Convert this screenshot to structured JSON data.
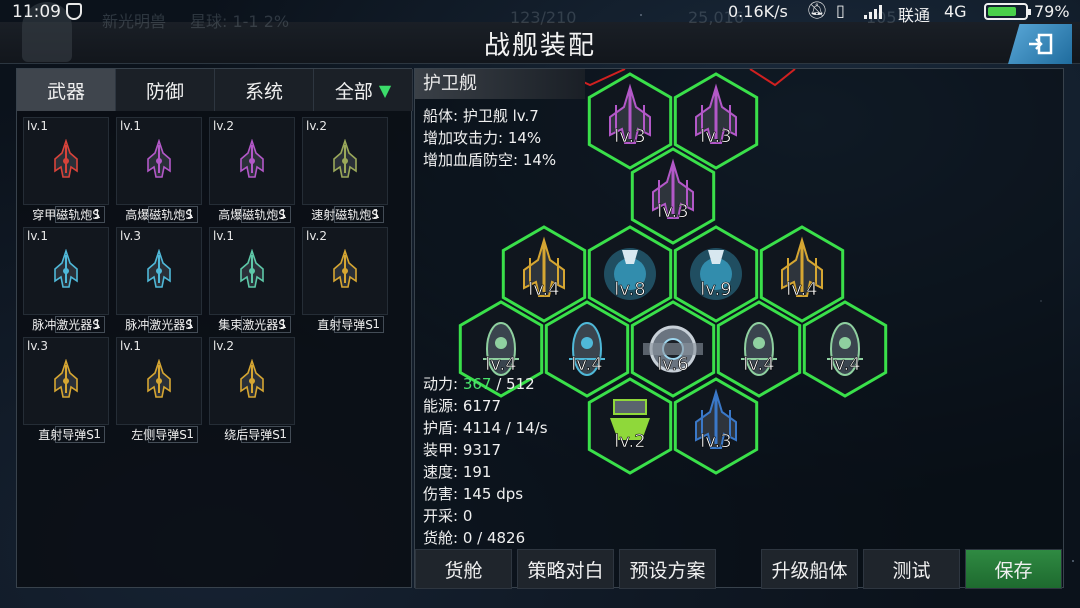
{
  "status_bar": {
    "time": "11:09",
    "net_speed": "0.16K/s",
    "carrier": "联通",
    "network": "4G",
    "battery_pct": "79%",
    "battery_level": 0.79
  },
  "game_bar": {
    "player_name": "新光明兽",
    "planet": "星球: 1-1  2%",
    "stat_a": "123/210",
    "stat_b": "25,016",
    "stat_c": "105"
  },
  "header": {
    "title": "战舰装配"
  },
  "left_panel": {
    "tabs": [
      {
        "label": "武器",
        "active": true
      },
      {
        "label": "防御",
        "active": false
      },
      {
        "label": "系统",
        "active": false
      },
      {
        "label": "全部",
        "active": false
      }
    ],
    "items": [
      {
        "level": "lv.1",
        "count": "1",
        "name": "穿甲磁轨炮S",
        "color": "#d8433a"
      },
      {
        "level": "lv.1",
        "count": "1",
        "name": "高爆磁轨炮S",
        "color": "#b358c8"
      },
      {
        "level": "lv.2",
        "count": "1",
        "name": "高爆磁轨炮S",
        "color": "#b358c8"
      },
      {
        "level": "lv.2",
        "count": "1",
        "name": "速射磁轨炮S",
        "color": "#9aa85a"
      },
      {
        "level": "lv.1",
        "count": "1",
        "name": "脉冲激光器S",
        "color": "#4fb8d8"
      },
      {
        "level": "lv.3",
        "count": "1",
        "name": "脉冲激光器S",
        "color": "#4fb8d8"
      },
      {
        "level": "lv.1",
        "count": "1",
        "name": "集束激光器S",
        "color": "#5ec8a8"
      },
      {
        "level": "lv.2",
        "count": "1",
        "name": "直射导弹S",
        "color": "#d6a632"
      },
      {
        "level": "lv.3",
        "count": "1",
        "name": "直射导弹S",
        "color": "#d6a632"
      },
      {
        "level": "lv.1",
        "count": "1",
        "name": "左侧导弹S",
        "color": "#d6a632"
      },
      {
        "level": "lv.2",
        "count": "1",
        "name": "绕后导弹S",
        "color": "#d6a632"
      }
    ]
  },
  "hull": {
    "name": "护卫舰",
    "hull_line": "船体: 护卫舰 lv.7",
    "atk_line": "增加攻击力: 14%",
    "hp_line": "增加血盾防空: 14%"
  },
  "stats": {
    "power_label": "动力: ",
    "power_used": "367",
    "power_total": " / 512",
    "energy": "能源: 6177",
    "shield": "护盾: 4114 / 14/s",
    "armor": "装甲: 9317",
    "speed": "速度: 191",
    "damage": "伤害: 145 dps",
    "mining": "开采: 0",
    "cargo": "货舱: 0 / 4826"
  },
  "modules": [
    {
      "label": "lv.3",
      "color": "#b358c8",
      "kind": "weapon"
    },
    {
      "label": "lv.3",
      "color": "#b358c8",
      "kind": "weapon"
    },
    {
      "label": "lv.3",
      "color": "#b358c8",
      "kind": "weapon"
    },
    {
      "label": "lv.4",
      "color": "#d6a632",
      "kind": "weapon"
    },
    {
      "label": "lv.8",
      "color": "#3fb8e0",
      "kind": "orb"
    },
    {
      "label": "lv.9",
      "color": "#3fb8e0",
      "kind": "orb"
    },
    {
      "label": "lv.4",
      "color": "#d6a632",
      "kind": "weapon"
    },
    {
      "label": "lv.4",
      "color": "#8fd0a0",
      "kind": "pod"
    },
    {
      "label": "lv.4",
      "color": "#4fb8d8",
      "kind": "pod"
    },
    {
      "label": "lv.6",
      "color": "#c8d0d8",
      "kind": "core"
    },
    {
      "label": "lv.4",
      "color": "#8fd0a0",
      "kind": "pod"
    },
    {
      "label": "lv.4",
      "color": "#8fd0a0",
      "kind": "pod"
    },
    {
      "label": "lv.2",
      "color": "#8fd83a",
      "kind": "engine"
    },
    {
      "label": "lv.3",
      "color": "#3a78c8",
      "kind": "weapon"
    }
  ],
  "bottom_buttons": {
    "cargo": "货舱",
    "strategy": "策略对白",
    "preset": "预设方案",
    "upgrade": "升级船体",
    "test": "测试",
    "save": "保存"
  },
  "colors": {
    "hex_border": "#3ae04a",
    "save_green": "#2f8a42",
    "highlight_green": "#4ae36c",
    "hex_red_edge": "#d02020"
  }
}
